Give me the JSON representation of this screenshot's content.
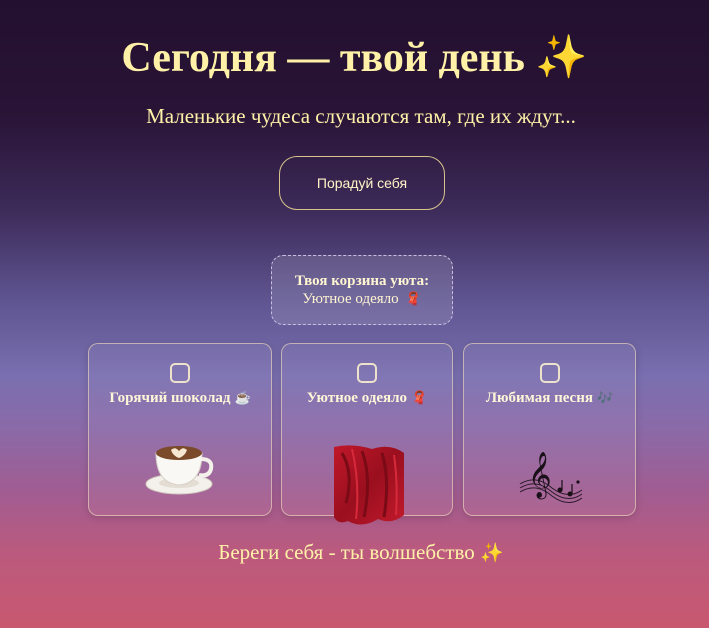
{
  "header": {
    "title": "Сегодня — твой день",
    "title_emoji": "✨",
    "subtitle": "Маленькие чудеса случаются там, где их ждут..."
  },
  "cta": {
    "label": "Порадуй себя"
  },
  "basket": {
    "title": "Твоя корзина уюта:",
    "item": "Уютное одеяло",
    "item_emoji": "🧣"
  },
  "cards": [
    {
      "label": "Горячий шоколад",
      "emoji": "☕",
      "image": "coffee-cup-icon",
      "checked": false
    },
    {
      "label": "Уютное одеяло",
      "emoji": "🧣",
      "image": "red-blanket-icon",
      "checked": false
    },
    {
      "label": "Любимая песня",
      "emoji": "🎶",
      "image": "treble-clef-icon",
      "checked": false
    }
  ],
  "footer": {
    "text": "Береги себя - ты волшебство",
    "emoji": "✨"
  },
  "colors": {
    "accent_text": "#fff2a8",
    "background_top": "#230f2f",
    "background_mid": "#7a6fb0",
    "background_bottom": "#c8586f"
  }
}
